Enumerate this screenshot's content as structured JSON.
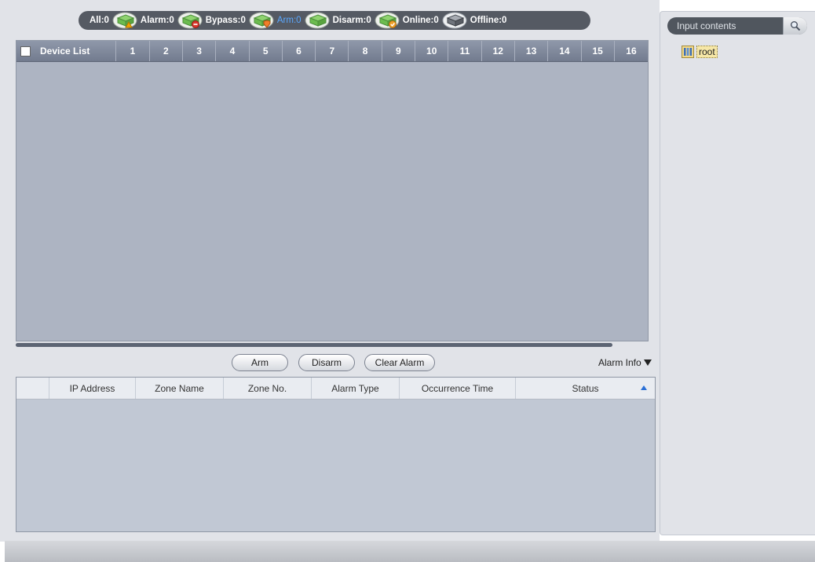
{
  "status_bar": {
    "items": [
      {
        "label": "All:0",
        "icon": "all-devices-icon",
        "active": false
      },
      {
        "label": "Alarm:0",
        "icon": "alarm-device-icon",
        "active": false
      },
      {
        "label": "Bypass:0",
        "icon": "bypass-device-icon",
        "active": false
      },
      {
        "label": "Arm:0",
        "icon": "arm-device-icon",
        "active": true
      },
      {
        "label": "Disarm:0",
        "icon": "disarm-device-icon",
        "active": false
      },
      {
        "label": "Online:0",
        "icon": "online-device-icon",
        "active": false
      },
      {
        "label": "Offline:0",
        "icon": "offline-device-icon",
        "active": false
      }
    ],
    "active_color": "#5aa8ff"
  },
  "device_grid": {
    "first_column": "Device List",
    "columns": [
      "1",
      "2",
      "3",
      "4",
      "5",
      "6",
      "7",
      "8",
      "9",
      "10",
      "11",
      "12",
      "13",
      "14",
      "15",
      "16"
    ]
  },
  "actions": {
    "arm": "Arm",
    "disarm": "Disarm",
    "clear_alarm": "Clear Alarm",
    "alarm_info": "Alarm Info"
  },
  "alarm_table": {
    "columns": [
      "",
      "IP Address",
      "Zone Name",
      "Zone No.",
      "Alarm Type",
      "Occurrence Time",
      "Status"
    ],
    "rows": []
  },
  "sidebar": {
    "search_placeholder": "Input contents",
    "tree": [
      {
        "label": "root",
        "icon": "device-group-icon"
      }
    ]
  }
}
